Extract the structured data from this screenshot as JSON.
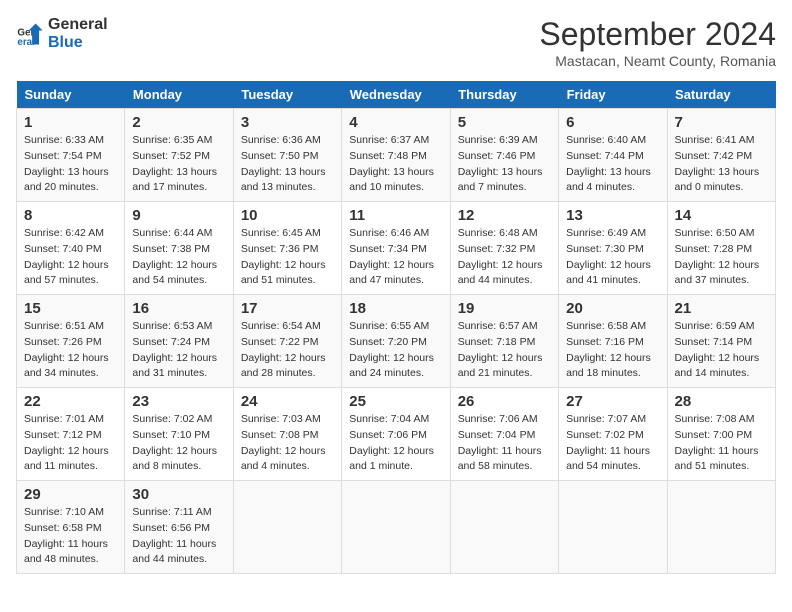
{
  "header": {
    "logo_line1": "General",
    "logo_line2": "Blue",
    "main_title": "September 2024",
    "subtitle": "Mastacan, Neamt County, Romania"
  },
  "weekdays": [
    "Sunday",
    "Monday",
    "Tuesday",
    "Wednesday",
    "Thursday",
    "Friday",
    "Saturday"
  ],
  "weeks": [
    [
      {
        "num": "1",
        "sunrise": "6:33 AM",
        "sunset": "7:54 PM",
        "daylight": "13 hours and 20 minutes."
      },
      {
        "num": "2",
        "sunrise": "6:35 AM",
        "sunset": "7:52 PM",
        "daylight": "13 hours and 17 minutes."
      },
      {
        "num": "3",
        "sunrise": "6:36 AM",
        "sunset": "7:50 PM",
        "daylight": "13 hours and 13 minutes."
      },
      {
        "num": "4",
        "sunrise": "6:37 AM",
        "sunset": "7:48 PM",
        "daylight": "13 hours and 10 minutes."
      },
      {
        "num": "5",
        "sunrise": "6:39 AM",
        "sunset": "7:46 PM",
        "daylight": "13 hours and 7 minutes."
      },
      {
        "num": "6",
        "sunrise": "6:40 AM",
        "sunset": "7:44 PM",
        "daylight": "13 hours and 4 minutes."
      },
      {
        "num": "7",
        "sunrise": "6:41 AM",
        "sunset": "7:42 PM",
        "daylight": "13 hours and 0 minutes."
      }
    ],
    [
      {
        "num": "8",
        "sunrise": "6:42 AM",
        "sunset": "7:40 PM",
        "daylight": "12 hours and 57 minutes."
      },
      {
        "num": "9",
        "sunrise": "6:44 AM",
        "sunset": "7:38 PM",
        "daylight": "12 hours and 54 minutes."
      },
      {
        "num": "10",
        "sunrise": "6:45 AM",
        "sunset": "7:36 PM",
        "daylight": "12 hours and 51 minutes."
      },
      {
        "num": "11",
        "sunrise": "6:46 AM",
        "sunset": "7:34 PM",
        "daylight": "12 hours and 47 minutes."
      },
      {
        "num": "12",
        "sunrise": "6:48 AM",
        "sunset": "7:32 PM",
        "daylight": "12 hours and 44 minutes."
      },
      {
        "num": "13",
        "sunrise": "6:49 AM",
        "sunset": "7:30 PM",
        "daylight": "12 hours and 41 minutes."
      },
      {
        "num": "14",
        "sunrise": "6:50 AM",
        "sunset": "7:28 PM",
        "daylight": "12 hours and 37 minutes."
      }
    ],
    [
      {
        "num": "15",
        "sunrise": "6:51 AM",
        "sunset": "7:26 PM",
        "daylight": "12 hours and 34 minutes."
      },
      {
        "num": "16",
        "sunrise": "6:53 AM",
        "sunset": "7:24 PM",
        "daylight": "12 hours and 31 minutes."
      },
      {
        "num": "17",
        "sunrise": "6:54 AM",
        "sunset": "7:22 PM",
        "daylight": "12 hours and 28 minutes."
      },
      {
        "num": "18",
        "sunrise": "6:55 AM",
        "sunset": "7:20 PM",
        "daylight": "12 hours and 24 minutes."
      },
      {
        "num": "19",
        "sunrise": "6:57 AM",
        "sunset": "7:18 PM",
        "daylight": "12 hours and 21 minutes."
      },
      {
        "num": "20",
        "sunrise": "6:58 AM",
        "sunset": "7:16 PM",
        "daylight": "12 hours and 18 minutes."
      },
      {
        "num": "21",
        "sunrise": "6:59 AM",
        "sunset": "7:14 PM",
        "daylight": "12 hours and 14 minutes."
      }
    ],
    [
      {
        "num": "22",
        "sunrise": "7:01 AM",
        "sunset": "7:12 PM",
        "daylight": "12 hours and 11 minutes."
      },
      {
        "num": "23",
        "sunrise": "7:02 AM",
        "sunset": "7:10 PM",
        "daylight": "12 hours and 8 minutes."
      },
      {
        "num": "24",
        "sunrise": "7:03 AM",
        "sunset": "7:08 PM",
        "daylight": "12 hours and 4 minutes."
      },
      {
        "num": "25",
        "sunrise": "7:04 AM",
        "sunset": "7:06 PM",
        "daylight": "12 hours and 1 minute."
      },
      {
        "num": "26",
        "sunrise": "7:06 AM",
        "sunset": "7:04 PM",
        "daylight": "11 hours and 58 minutes."
      },
      {
        "num": "27",
        "sunrise": "7:07 AM",
        "sunset": "7:02 PM",
        "daylight": "11 hours and 54 minutes."
      },
      {
        "num": "28",
        "sunrise": "7:08 AM",
        "sunset": "7:00 PM",
        "daylight": "11 hours and 51 minutes."
      }
    ],
    [
      {
        "num": "29",
        "sunrise": "7:10 AM",
        "sunset": "6:58 PM",
        "daylight": "11 hours and 48 minutes."
      },
      {
        "num": "30",
        "sunrise": "7:11 AM",
        "sunset": "6:56 PM",
        "daylight": "11 hours and 44 minutes."
      },
      null,
      null,
      null,
      null,
      null
    ]
  ]
}
